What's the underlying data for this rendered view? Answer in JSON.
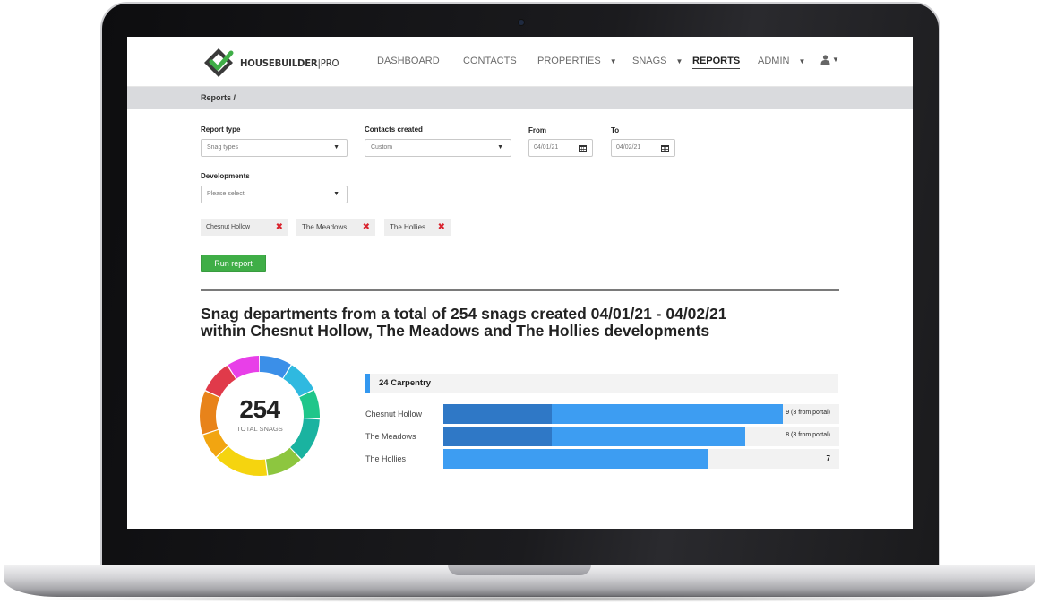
{
  "brand": {
    "name_part1": "HOUSEBUILDER",
    "name_separator": "|",
    "name_part2": "PRO"
  },
  "nav": {
    "items": [
      {
        "label": "DASHBOARD",
        "dropdown": false
      },
      {
        "label": "CONTACTS",
        "dropdown": false
      },
      {
        "label": "PROPERTIES",
        "dropdown": true
      },
      {
        "label": "SNAGS",
        "dropdown": true
      },
      {
        "label": "REPORTS",
        "dropdown": false,
        "active": true
      },
      {
        "label": "ADMIN",
        "dropdown": true
      }
    ],
    "user_icon": "user-icon",
    "caret_glyph": "▼"
  },
  "breadcrumb": "Reports /",
  "form": {
    "report_type": {
      "label": "Report type",
      "value": "Snag types"
    },
    "contacts_created": {
      "label": "Contacts created",
      "value": "Custom"
    },
    "from": {
      "label": "From",
      "value": "04/01/21"
    },
    "to": {
      "label": "To",
      "value": "04/02/21"
    },
    "developments": {
      "label": "Developments",
      "placeholder": "Please select"
    },
    "selected_developments": [
      {
        "label": "Chesnut Hollow"
      },
      {
        "label": "The Meadows"
      },
      {
        "label": "The Hollies"
      }
    ],
    "remove_glyph": "✖",
    "run_button": "Run report"
  },
  "report": {
    "heading_line1": "Snag departments from a total of 254 snags created 04/01/21 - 04/02/21",
    "heading_line2": "within Chesnut Hollow, The Meadows and The Hollies developments",
    "total": "254",
    "total_label": "TOTAL SNAGS",
    "category": "24 Carpentry"
  },
  "chart_data": {
    "type": "bar",
    "orientation": "horizontal",
    "categories": [
      "Chesnut Hollow",
      "The Meadows",
      "The Hollies"
    ],
    "series": [
      {
        "values": [
          9,
          8,
          7
        ]
      },
      {
        "values": [
          3,
          3,
          0
        ]
      }
    ],
    "value_labels": [
      "9 (3 from portal)",
      "8 (3 from portal)",
      "7"
    ],
    "xlim": [
      0,
      10.5
    ],
    "colors": {
      "total": "#3d9df2",
      "portal": "#2f78c6"
    }
  },
  "donut": {
    "colors": [
      "#3b8fe8",
      "#2fb9e0",
      "#1fc68a",
      "#1ab3a0",
      "#8dc63f",
      "#f5d40f",
      "#f2a511",
      "#e8831a",
      "#e03a4a",
      "#e83fe8"
    ],
    "fractions": [
      0.09,
      0.09,
      0.08,
      0.12,
      0.1,
      0.15,
      0.07,
      0.12,
      0.09,
      0.09
    ]
  }
}
